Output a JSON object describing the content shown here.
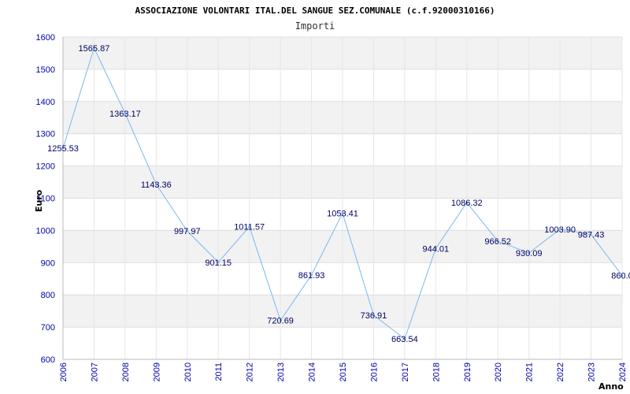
{
  "header": {
    "title": "ASSOCIAZIONE VOLONTARI ITAL.DEL SANGUE SEZ.COMUNALE (c.f.92000310166)",
    "subtitle": "Importi"
  },
  "colors": {
    "line": "#7ab8f0",
    "band": "#f2f2f2",
    "tick_text": "#0000aa",
    "label_text": "#000066"
  },
  "chart_data": {
    "type": "line",
    "title": "ASSOCIAZIONE VOLONTARI ITAL.DEL SANGUE SEZ.COMUNALE (c.f.92000310166)",
    "subtitle": "Importi",
    "xlabel": "Anno",
    "ylabel": "Euro",
    "ylim": [
      600,
      1600
    ],
    "yticks": [
      600,
      700,
      800,
      900,
      1000,
      1100,
      1200,
      1300,
      1400,
      1500,
      1600
    ],
    "grid": true,
    "categories": [
      "2006",
      "2007",
      "2008",
      "2009",
      "2010",
      "2011",
      "2012",
      "2013",
      "2014",
      "2015",
      "2016",
      "2017",
      "2018",
      "2019",
      "2020",
      "2021",
      "2022",
      "2023",
      "2024"
    ],
    "series": [
      {
        "values": [
          1255.53,
          1565.87,
          1363.17,
          1143.36,
          997.97,
          901.15,
          1011.57,
          720.69,
          861.93,
          1053.41,
          736.91,
          663.54,
          944.01,
          1086.32,
          966.52,
          930.09,
          1003.9,
          987.43,
          860.0
        ],
        "labels": [
          "1255.53",
          "1565.87",
          "1363.17",
          "1143.36",
          "997.97",
          "901.15",
          "1011.57",
          "720.69",
          "861.93",
          "1053.41",
          "736.91",
          "663.54",
          "944.01",
          "1086.32",
          "966.52",
          "930.09",
          "1003.90",
          "987.43",
          "860.0"
        ]
      }
    ]
  }
}
